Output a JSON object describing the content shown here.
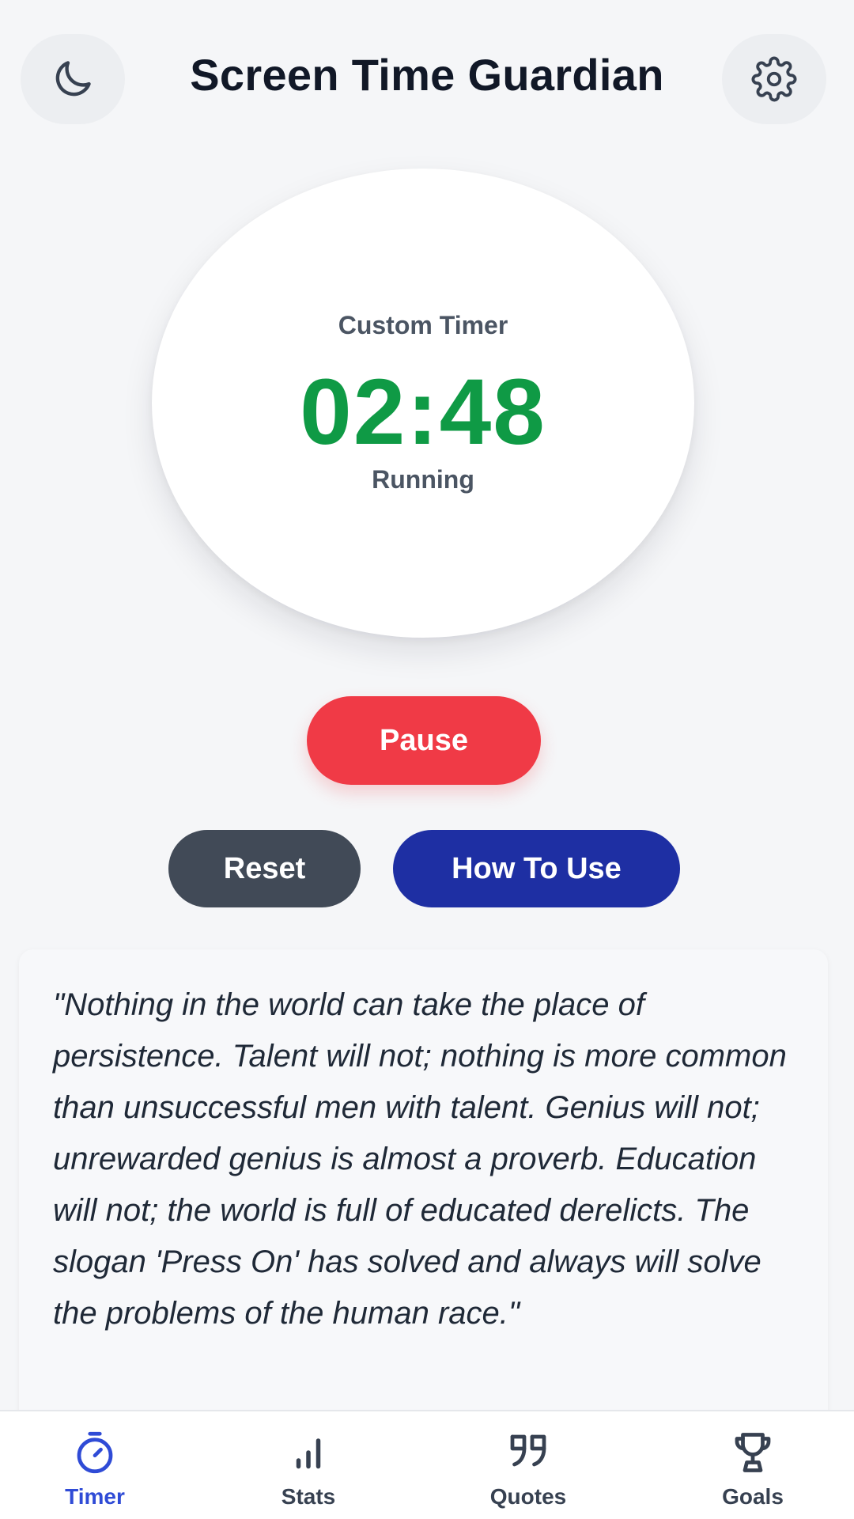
{
  "header": {
    "title": "Screen Time Guardian",
    "theme_icon": "moon-icon",
    "settings_icon": "gear-icon"
  },
  "timer": {
    "mode": "Custom Timer",
    "time": "02:48",
    "status": "Running",
    "time_color": "#0f9a45"
  },
  "controls": {
    "pause_label": "Pause",
    "reset_label": "Reset",
    "howto_label": "How To Use"
  },
  "quote": {
    "text": "\"Nothing in the world can take the place of persistence. Talent will not; nothing is more common than unsuccessful men with talent. Genius will not; unrewarded genius is almost a proverb. Education will not; the world is full of educated derelicts. The slogan 'Press On' has solved and always will solve the problems of the human race.\""
  },
  "nav": {
    "items": [
      {
        "label": "Timer",
        "icon": "stopwatch-icon",
        "active": true
      },
      {
        "label": "Stats",
        "icon": "bar-chart-icon",
        "active": false
      },
      {
        "label": "Quotes",
        "icon": "quote-icon",
        "active": false
      },
      {
        "label": "Goals",
        "icon": "trophy-icon",
        "active": false
      }
    ]
  },
  "colors": {
    "background": "#f5f6f8",
    "pause": "#f03a46",
    "reset": "#414a57",
    "howto": "#1e2fa3",
    "nav_active": "#2f4bd6"
  }
}
